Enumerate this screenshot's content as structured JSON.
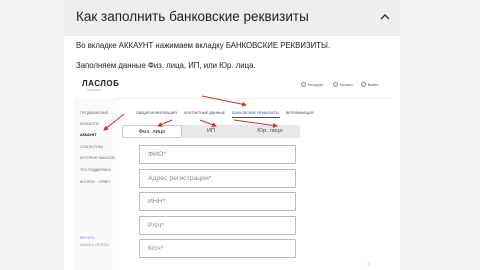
{
  "accordion": {
    "title": "Как заполнить банковские реквизиты"
  },
  "content": {
    "paragraph1": "Во вкладке АККАУНТ нажимаем вкладку БАНКОВСКИЕ РЕКВИЗИТЫ.",
    "paragraph2": "Заполняем данные Физ. лица, ИП, или Юр. лица."
  },
  "screenshot": {
    "logo": "ЛАСЛОБ",
    "logo_sub": "STUDIO",
    "topbar": {
      "lang": "Беларусь",
      "user": "Михаил",
      "exit": "Выйти"
    },
    "sidebar": {
      "items": [
        "ПРОДВИЖЕНИЕ",
        "КАТАЛОГИ",
        "АККАУНТ",
        "СТАТИСТИКА",
        "ИСТОРИЯ ЗАКАЗОВ",
        "ТЕХ.ПОДДЕРЖКА",
        "ВОПРОС - ОТВЕТ"
      ],
      "footer": [
        "ВЕРНУТЬ",
        "СКАЧАТЬ ОТЧЁТЫ"
      ]
    },
    "subnav": [
      "ОБЩАЯ ИНФОРМАЦИЯ",
      "КОНТАКТНЫЕ ДАННЫЕ",
      "БАНКОВСКИЕ РЕКВИЗИТЫ",
      "ВЕРИФИКАЦИЯ"
    ],
    "tabs": [
      "Физ. лицо",
      "ИП",
      "Юр. лицо"
    ],
    "fields": [
      "ФИО*",
      "Адрес регистрации*",
      "ИНН*",
      "Р/сч*",
      "К/сч*"
    ]
  },
  "watermark": "© ..."
}
